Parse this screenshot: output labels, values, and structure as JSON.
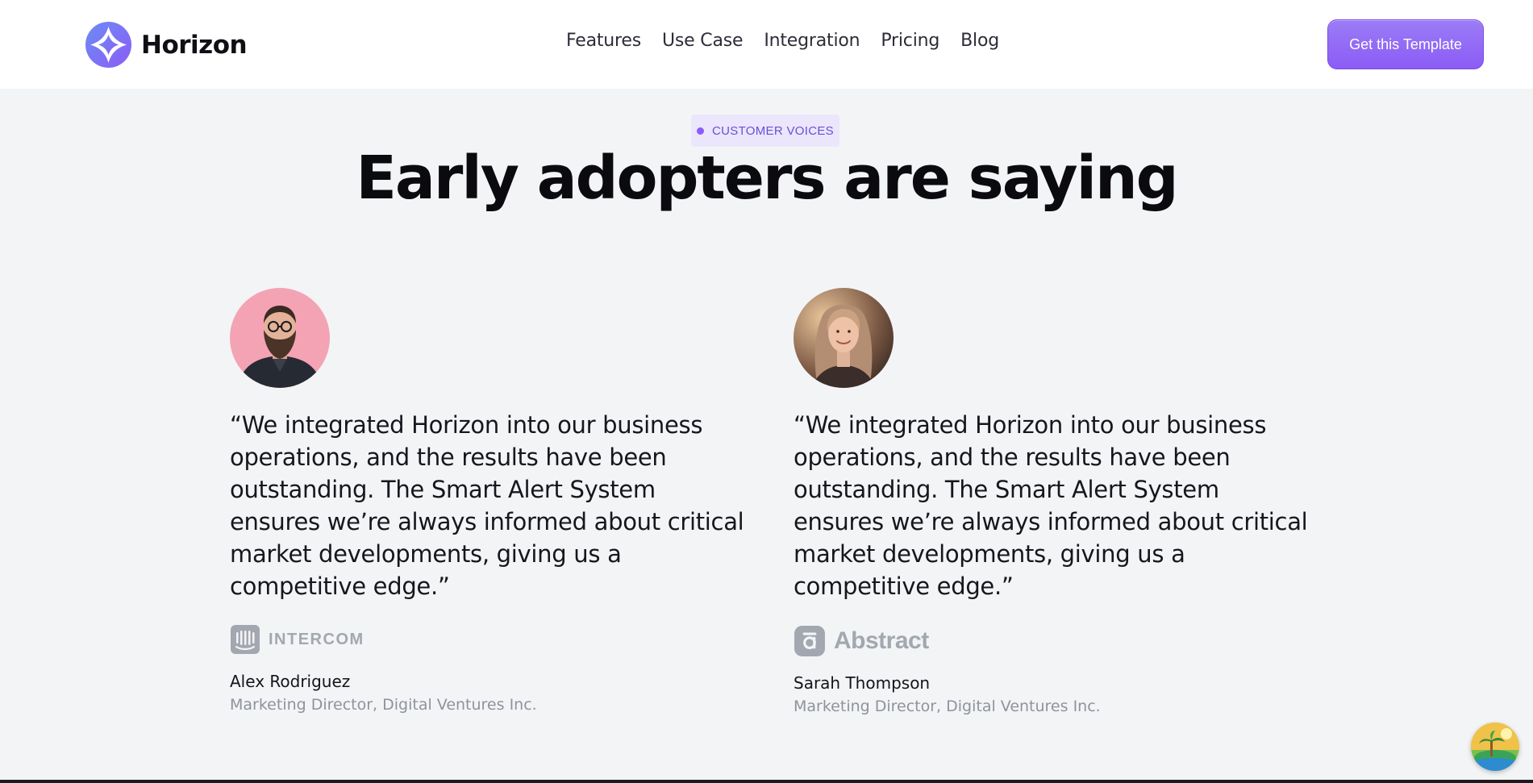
{
  "header": {
    "brand_name": "Horizon",
    "nav": [
      "Features",
      "Use Case",
      "Integration",
      "Pricing",
      "Blog"
    ],
    "cta_label": "Get this Template"
  },
  "hero": {
    "badge": "CUSTOMER VOICES",
    "title": "Early adopters are saying"
  },
  "testimonials": [
    {
      "quote": "“We integrated Horizon into our business operations, and the results have been outstanding. The Smart Alert System ensures we’re always informed about critical market developments, giving us a competitive edge.”",
      "company": "INTERCOM",
      "company_icon": "intercom-logo-icon",
      "name": "Alex Rodriguez",
      "role": "Marketing Director, Digital Ventures Inc."
    },
    {
      "quote": "“We integrated Horizon into our business operations, and the results have been outstanding. The Smart Alert System ensures we’re always informed about critical market developments, giving us a competitive edge.”",
      "company": "Abstract",
      "company_icon": "abstract-logo-icon",
      "name": "Sarah Thompson",
      "role": "Marketing Director, Digital Ventures Inc."
    }
  ],
  "colors": {
    "accent": "#8b5cf6",
    "background": "#f3f4f6",
    "header_bg": "#ffffff",
    "muted_text": "#8e939c"
  }
}
